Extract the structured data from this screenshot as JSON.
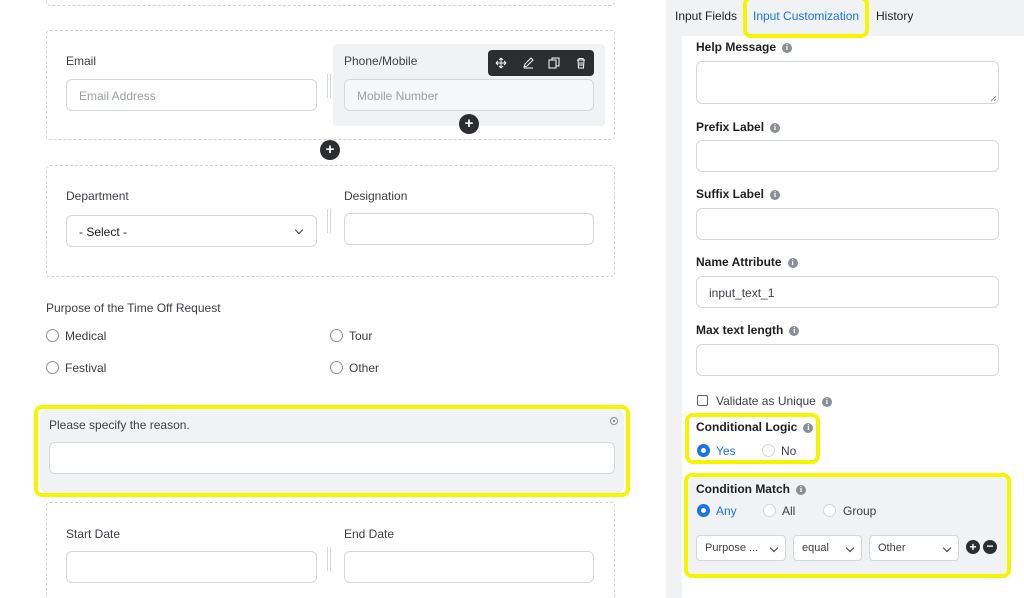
{
  "form": {
    "email": {
      "label": "Email",
      "placeholder": "Email Address"
    },
    "phone": {
      "label": "Phone/Mobile",
      "placeholder": "Mobile Number"
    },
    "department": {
      "label": "Department",
      "selected": "- Select -"
    },
    "designation": {
      "label": "Designation"
    },
    "purpose": {
      "label": "Purpose of the Time Off Request",
      "options": [
        "Medical",
        "Tour",
        "Festival",
        "Other"
      ]
    },
    "reason": {
      "label": "Please specify the reason."
    },
    "start_date": {
      "label": "Start Date"
    },
    "end_date": {
      "label": "End Date"
    }
  },
  "panel": {
    "tabs": [
      "Input Fields",
      "Input Customization",
      "History"
    ],
    "help_message": {
      "label": "Help Message"
    },
    "prefix_label": {
      "label": "Prefix Label"
    },
    "suffix_label": {
      "label": "Suffix Label"
    },
    "name_attribute": {
      "label": "Name Attribute",
      "value": "input_text_1"
    },
    "max_text_length": {
      "label": "Max text length"
    },
    "validate_unique": {
      "label": "Validate as Unique"
    },
    "conditional_logic": {
      "label": "Conditional Logic",
      "options": [
        "Yes",
        "No"
      ],
      "selected": "Yes"
    },
    "condition_match": {
      "label": "Condition Match",
      "options": [
        "Any",
        "All",
        "Group"
      ],
      "selected": "Any",
      "rule": {
        "field": "Purpose ...",
        "operator": "equal",
        "value": "Other"
      }
    }
  },
  "icons": {
    "info": "i",
    "plus": "+",
    "minus": "−"
  },
  "colors": {
    "accent": "#1a73e8",
    "highlight": "#f5f500",
    "panel_bg": "#f1f2f4"
  }
}
